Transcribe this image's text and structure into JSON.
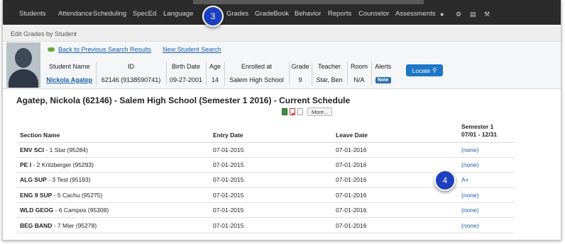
{
  "nav": {
    "items": [
      "Students",
      "Attendance",
      "Scheduling",
      "SpecEd",
      "Language",
      "Grades",
      "GradeBook",
      "Behavior",
      "Reports",
      "Counselor",
      "Assessments"
    ],
    "icons": [
      "chat-icon",
      "gear-icon",
      "inbox-icon",
      "wrench-icon"
    ]
  },
  "page": {
    "title": "Edit Grades by Student"
  },
  "student": {
    "links": {
      "back": "Back to Previous Search Results",
      "new_search": "New Student Search"
    },
    "headers": {
      "name": "Student Name",
      "id": "ID",
      "birth": "Birth Date",
      "age": "Age",
      "enrolled": "Enrolled at",
      "grade": "Grade",
      "teacher": "Teacher",
      "room": "Room",
      "alerts": "Alerts"
    },
    "values": {
      "name": "Nickola Agatep",
      "id": "62146 (9138590741)",
      "birth": "09-27-2001",
      "age": "14",
      "enrolled": "Salem High School",
      "grade": "9",
      "teacher": "Star, Ben",
      "room": "N/A",
      "alerts": "Note"
    },
    "locate_label": "Locate"
  },
  "schedule": {
    "title": "Agatep, Nickola (62146) - Salem High School (Semester 1 2016) - Current Schedule",
    "more_label": "More...",
    "headers": {
      "section": "Section Name",
      "entry": "Entry Date",
      "leave": "Leave Date",
      "sem_line1": "Semester 1",
      "sem_line2": "07/01 - 12/31"
    },
    "rows": [
      {
        "code": "ENV SCI",
        "rest": " - 1 Star (95284)",
        "entry": "07-01-2015",
        "leave": "07-01-2016",
        "grade": "(none)"
      },
      {
        "code": "PE I",
        "rest": " - 2 Kritzberger (95293)",
        "entry": "07-01-2015",
        "leave": "07-01-2016",
        "grade": "(none)"
      },
      {
        "code": "ALG SUP",
        "rest": " - 3 Test (95193)",
        "entry": "07-01-2015",
        "leave": "07-01-2016",
        "grade": "A+"
      },
      {
        "code": "ENG 9 SUP",
        "rest": " - 5 Cachu (95275)",
        "entry": "07-01-2015",
        "leave": "07-01-2016",
        "grade": "(none)"
      },
      {
        "code": "WLD GEOG",
        "rest": " - 6 Campos (95308)",
        "entry": "07-01-2015",
        "leave": "07-01-2016",
        "grade": "(none)"
      },
      {
        "code": "BEG BAND",
        "rest": " - 7 Mier (95278)",
        "entry": "07-01-2015",
        "leave": "07-01-2016",
        "grade": "(none)"
      }
    ]
  },
  "callouts": [
    "3",
    "4"
  ],
  "colors": {
    "nav_bg": "#2b2b2b",
    "link": "#1a5fa6",
    "accent_button": "#1e76c7",
    "callout": "#1e3fbf"
  }
}
